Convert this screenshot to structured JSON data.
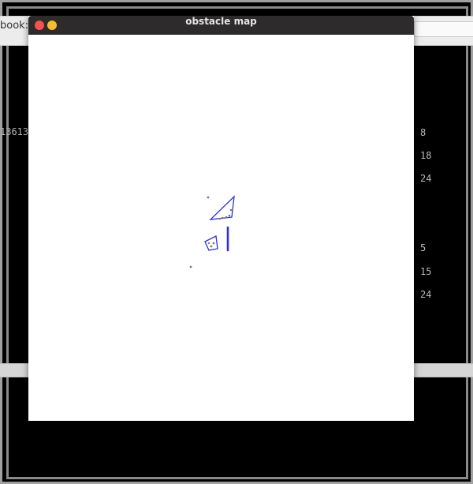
{
  "window": {
    "title": "obstacle map"
  },
  "background_terminal": {
    "title_fragment": "book:",
    "left_fragment": "13613",
    "right_column_top": [
      "8",
      "18",
      "24"
    ],
    "right_column_bottom": [
      "5",
      "15",
      "24"
    ]
  },
  "map": {
    "obstacle_color": "#2f2fd8",
    "point_color": "#7a7a7a"
  }
}
